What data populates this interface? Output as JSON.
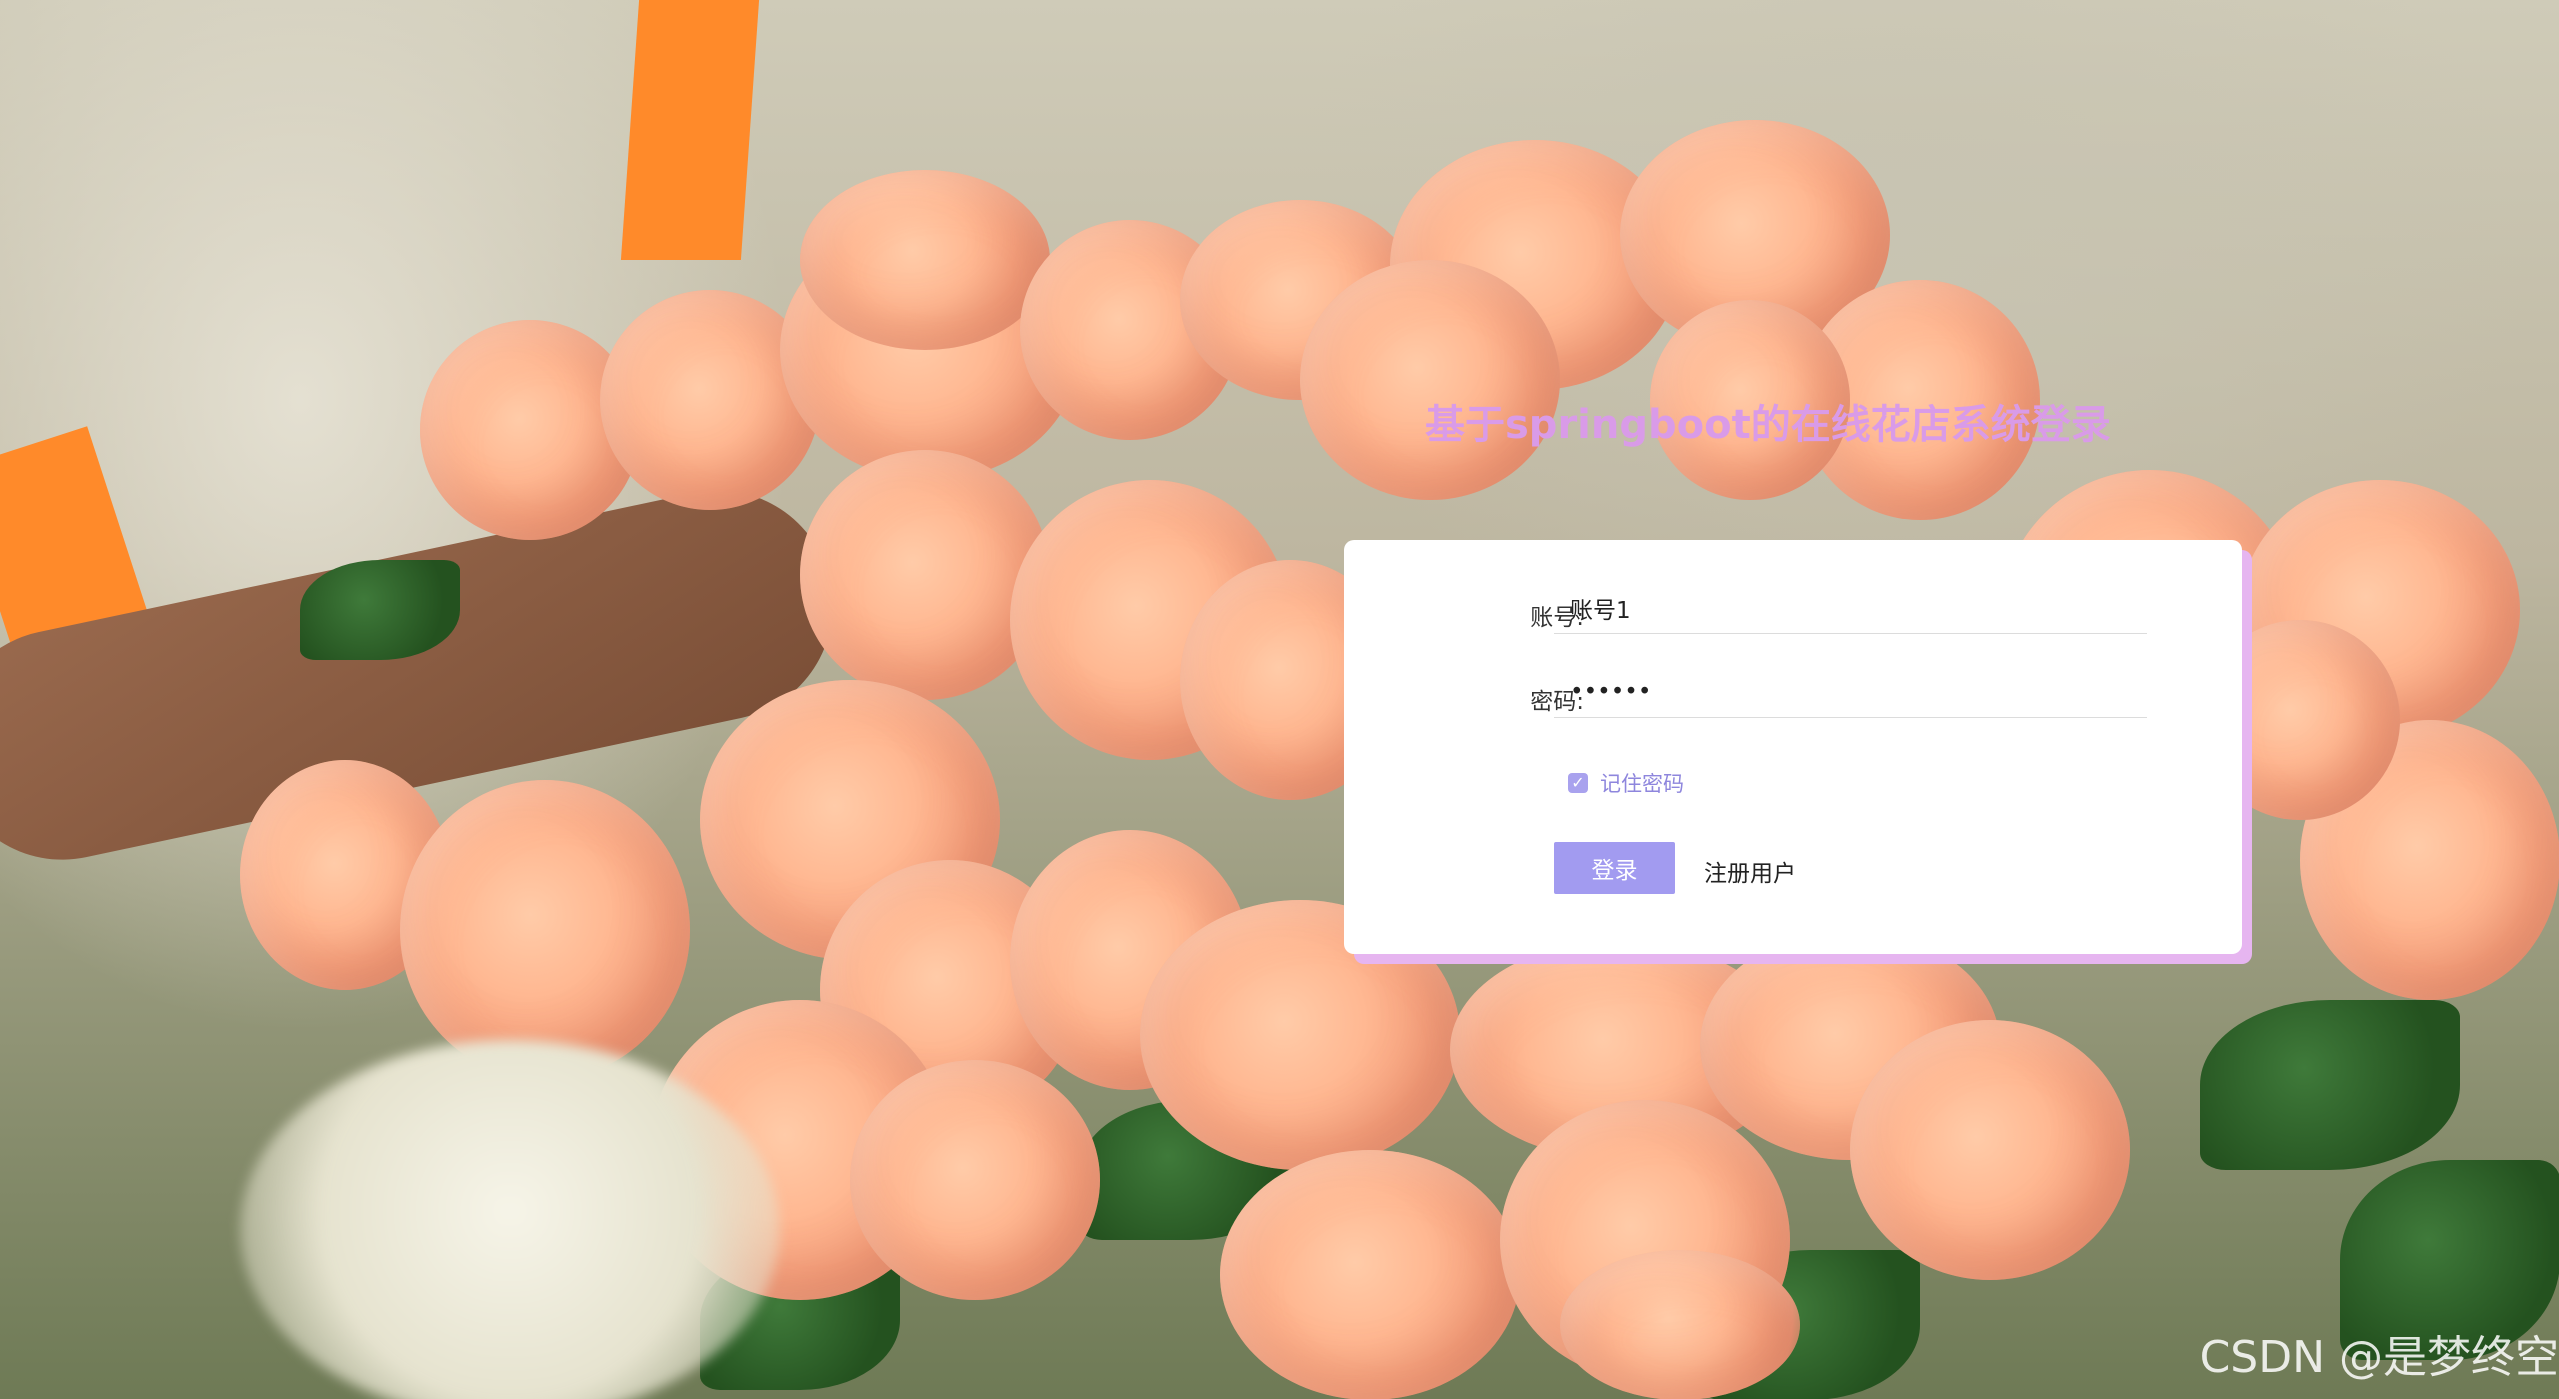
{
  "page": {
    "title": "基于springboot的在线花店系统登录",
    "watermark": "CSDN @是梦终空"
  },
  "form": {
    "account_label": "账号:",
    "account_value": "账号1",
    "password_label": "密码:",
    "password_value": "••••••",
    "remember_label": "记住密码",
    "remember_checked": true,
    "login_label": "登录",
    "register_label": "注册用户"
  },
  "colors": {
    "title": "#d99be8",
    "accent": "#a29bf0",
    "card_shadow": "#e6b5f0",
    "checkbox_label": "#8e86dd"
  }
}
